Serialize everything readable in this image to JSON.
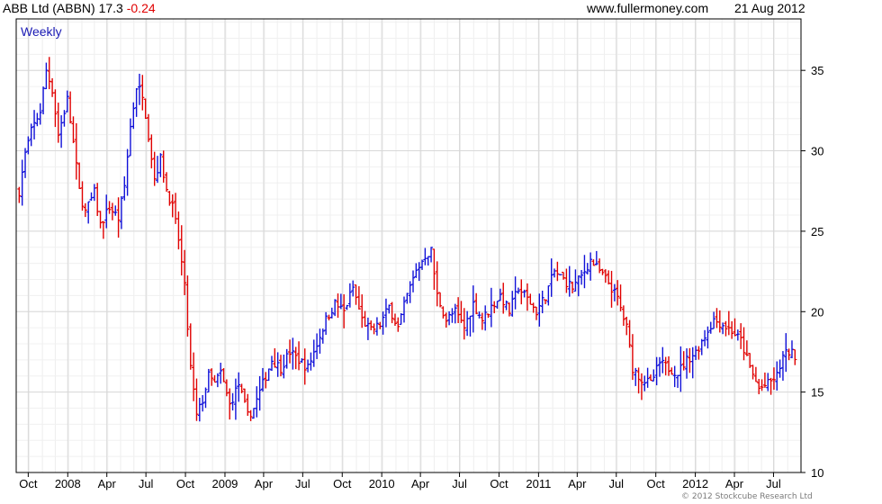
{
  "header": {
    "ticker": "ABB Ltd (ABBN)",
    "price": "17.3",
    "change": "-0.24",
    "site": "www.fullermoney.com",
    "date": "21 Aug 2012"
  },
  "copyright": "© 2012 Stockcube Research Ltd",
  "colors": {
    "up": "#1010d8",
    "down": "#e00000",
    "grid": "#d8d8d8",
    "axis": "#000000"
  },
  "chart_data": {
    "type": "ohlc",
    "period_label": "Weekly",
    "y_ticks": [
      10,
      15,
      20,
      25,
      30,
      35
    ],
    "ylim": [
      10,
      38.2
    ],
    "x_range": [
      "2007-09-03",
      "2012-09-03"
    ],
    "x_ticks": [
      {
        "label": "Oct",
        "date": "2007-10-01"
      },
      {
        "label": "2008",
        "date": "2008-01-01"
      },
      {
        "label": "Apr",
        "date": "2008-04-01"
      },
      {
        "label": "Jul",
        "date": "2008-07-01"
      },
      {
        "label": "Oct",
        "date": "2008-10-01"
      },
      {
        "label": "2009",
        "date": "2009-01-01"
      },
      {
        "label": "Apr",
        "date": "2009-04-01"
      },
      {
        "label": "Jul",
        "date": "2009-07-01"
      },
      {
        "label": "Oct",
        "date": "2009-10-01"
      },
      {
        "label": "2010",
        "date": "2010-01-01"
      },
      {
        "label": "Apr",
        "date": "2010-04-01"
      },
      {
        "label": "Jul",
        "date": "2010-07-01"
      },
      {
        "label": "Oct",
        "date": "2010-10-01"
      },
      {
        "label": "2011",
        "date": "2011-01-01"
      },
      {
        "label": "Apr",
        "date": "2011-04-01"
      },
      {
        "label": "Jul",
        "date": "2011-07-01"
      },
      {
        "label": "Oct",
        "date": "2011-10-01"
      },
      {
        "label": "2012",
        "date": "2012-01-01"
      },
      {
        "label": "Apr",
        "date": "2012-04-01"
      },
      {
        "label": "Jul",
        "date": "2012-07-01"
      }
    ],
    "close_path": [
      [
        "2007-09-10",
        27.5
      ],
      [
        "2007-09-24",
        29.8
      ],
      [
        "2007-10-08",
        31.2
      ],
      [
        "2007-10-29",
        32.5
      ],
      [
        "2007-11-12",
        35.0
      ],
      [
        "2007-11-26",
        33.8
      ],
      [
        "2007-12-10",
        31.0
      ],
      [
        "2007-12-31",
        33.2
      ],
      [
        "2008-01-14",
        30.5
      ],
      [
        "2008-01-28",
        27.5
      ],
      [
        "2008-02-11",
        26.2
      ],
      [
        "2008-03-03",
        27.4
      ],
      [
        "2008-03-17",
        25.4
      ],
      [
        "2008-04-07",
        26.5
      ],
      [
        "2008-04-28",
        25.8
      ],
      [
        "2008-05-12",
        27.8
      ],
      [
        "2008-05-26",
        31.5
      ],
      [
        "2008-06-09",
        34.0
      ],
      [
        "2008-06-23",
        33.6
      ],
      [
        "2008-07-07",
        31.0
      ],
      [
        "2008-07-21",
        28.3
      ],
      [
        "2008-08-04",
        29.5
      ],
      [
        "2008-08-18",
        27.6
      ],
      [
        "2008-09-01",
        26.5
      ],
      [
        "2008-09-15",
        24.5
      ],
      [
        "2008-09-29",
        21.5
      ],
      [
        "2008-10-13",
        16.5
      ],
      [
        "2008-10-27",
        13.5
      ],
      [
        "2008-11-10",
        14.5
      ],
      [
        "2008-11-24",
        16.0
      ],
      [
        "2008-12-08",
        15.5
      ],
      [
        "2008-12-22",
        16.2
      ],
      [
        "2009-01-12",
        14.2
      ],
      [
        "2009-02-02",
        15.5
      ],
      [
        "2009-02-23",
        13.5
      ],
      [
        "2009-03-09",
        14.0
      ],
      [
        "2009-03-30",
        15.5
      ],
      [
        "2009-04-20",
        17.0
      ],
      [
        "2009-05-11",
        16.5
      ],
      [
        "2009-06-01",
        17.5
      ],
      [
        "2009-06-22",
        17.0
      ],
      [
        "2009-07-13",
        16.5
      ],
      [
        "2009-08-03",
        18.0
      ],
      [
        "2009-08-24",
        19.5
      ],
      [
        "2009-09-14",
        20.5
      ],
      [
        "2009-10-05",
        20.0
      ],
      [
        "2009-10-26",
        21.5
      ],
      [
        "2009-11-16",
        19.5
      ],
      [
        "2009-12-07",
        18.8
      ],
      [
        "2009-12-28",
        19.2
      ],
      [
        "2010-01-18",
        20.3
      ],
      [
        "2010-02-08",
        19.0
      ],
      [
        "2010-03-01",
        21.0
      ],
      [
        "2010-03-22",
        22.5
      ],
      [
        "2010-04-12",
        23.5
      ],
      [
        "2010-04-26",
        23.8
      ],
      [
        "2010-05-10",
        21.0
      ],
      [
        "2010-05-31",
        19.5
      ],
      [
        "2010-06-21",
        20.0
      ],
      [
        "2010-07-12",
        19.0
      ],
      [
        "2010-08-02",
        20.5
      ],
      [
        "2010-08-23",
        19.5
      ],
      [
        "2010-09-13",
        20.3
      ],
      [
        "2010-10-04",
        21.0
      ],
      [
        "2010-10-25",
        20.0
      ],
      [
        "2010-11-15",
        21.5
      ],
      [
        "2010-12-06",
        20.8
      ],
      [
        "2010-12-27",
        20.0
      ],
      [
        "2011-01-17",
        21.0
      ],
      [
        "2011-02-07",
        22.5
      ],
      [
        "2011-02-28",
        22.0
      ],
      [
        "2011-03-21",
        21.5
      ],
      [
        "2011-04-11",
        22.2
      ],
      [
        "2011-05-02",
        23.2
      ],
      [
        "2011-05-23",
        22.5
      ],
      [
        "2011-06-13",
        21.8
      ],
      [
        "2011-07-04",
        20.8
      ],
      [
        "2011-07-25",
        19.0
      ],
      [
        "2011-08-08",
        16.5
      ],
      [
        "2011-08-29",
        15.8
      ],
      [
        "2011-09-19",
        15.5
      ],
      [
        "2011-10-10",
        16.8
      ],
      [
        "2011-10-31",
        16.5
      ],
      [
        "2011-11-21",
        16.2
      ],
      [
        "2011-12-12",
        17.0
      ],
      [
        "2012-01-02",
        17.5
      ],
      [
        "2012-01-23",
        18.5
      ],
      [
        "2012-02-13",
        19.5
      ],
      [
        "2012-03-05",
        19.2
      ],
      [
        "2012-03-26",
        18.8
      ],
      [
        "2012-04-16",
        18.2
      ],
      [
        "2012-05-07",
        16.5
      ],
      [
        "2012-05-28",
        15.2
      ],
      [
        "2012-06-18",
        15.5
      ],
      [
        "2012-07-09",
        16.0
      ],
      [
        "2012-07-23",
        17.2
      ],
      [
        "2012-08-06",
        17.5
      ],
      [
        "2012-08-20",
        17.3
      ]
    ]
  }
}
